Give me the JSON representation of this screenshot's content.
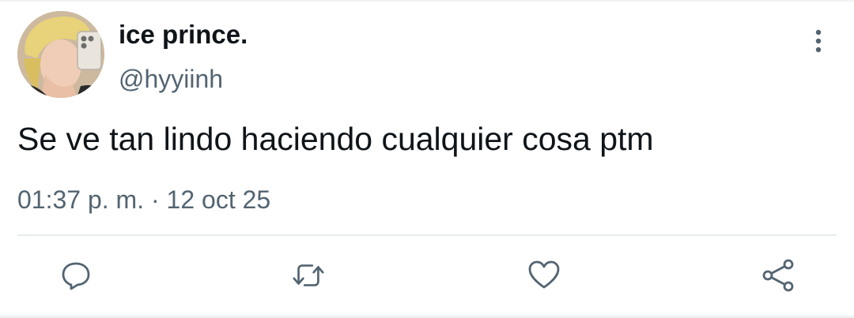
{
  "user": {
    "display_name": "ice prince.",
    "handle": "@hyyiinh"
  },
  "tweet": {
    "text": "Se ve tan lindo haciendo cualquier cosa ptm",
    "meta": "01:37 p. m. · 12 oct 25"
  },
  "actions": {
    "reply_icon": "reply-icon",
    "retweet_icon": "retweet-icon",
    "like_icon": "heart-icon",
    "share_icon": "share-icon",
    "more_icon": "more-vertical-icon"
  },
  "colors": {
    "text_primary": "#0f1419",
    "text_secondary": "#536471",
    "icon": "#536471",
    "divider": "#e6ebee"
  }
}
